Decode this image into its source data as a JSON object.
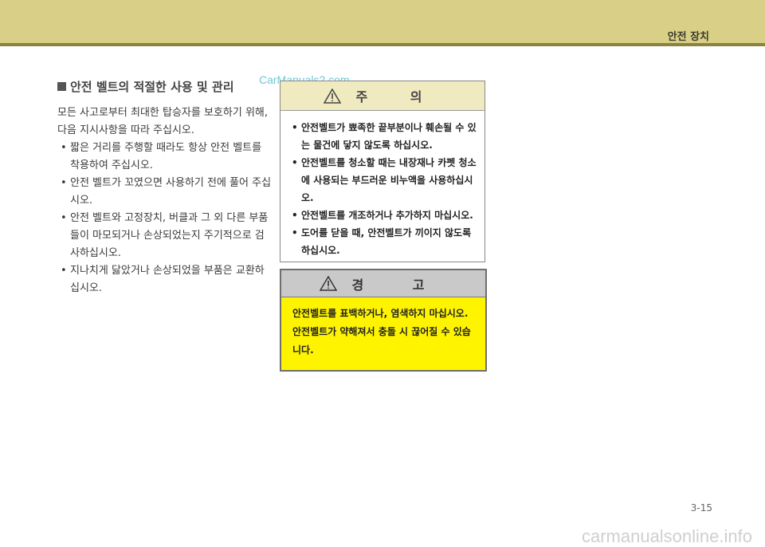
{
  "header": {
    "title": "안전 장치"
  },
  "watermark_top": "CarManuals2.com",
  "section": {
    "title": "안전 벨트의 적절한 사용 및 관리",
    "intro": "모든 사고로부터 최대한 탑승자를 보호하기 위해, 다음 지시사항을 따라 주십시오.",
    "bullets": [
      "짧은 거리를 주행할 때라도 항상 안전 벨트를 착용하여 주십시오.",
      "안전 벨트가 꼬였으면 사용하기 전에 풀어 주십시오.",
      "안전 벨트와 고정장치, 버클과 그 외 다른 부품들이 마모되거나 손상되었는지 주기적으로 검사하십시오.",
      "지나치게 닳았거나 손상되었을 부품은 교환하십시오."
    ]
  },
  "caution": {
    "title": "주 의",
    "items": [
      "안전벨트가 뾰족한 끝부분이나 훼손될 수 있는 물건에 닿지 않도록 하십시오.",
      "안전벨트를 청소할 때는 내장재나 카펫 청소에 사용되는 부드러운 비누액을 사용하십시오.",
      "안전벨트를 개조하거나 추가하지 마십시오.",
      "도어를 닫을 때, 안전벨트가 끼이지 않도록 하십시오."
    ]
  },
  "warning": {
    "title": "경 고",
    "text": "안전벨트를 표백하거나, 염색하지 마십시오. 안전벨트가 약해져서 충돌 시 끊어질 수 있습니다."
  },
  "page_number": "3-15",
  "watermark_bottom": "carmanualsonline.info",
  "colors": {
    "header_band": "#d9cf86",
    "caution_head": "#efeac0",
    "warning_bg": "#fff400"
  },
  "icons": [
    "warning-triangle-icon"
  ]
}
